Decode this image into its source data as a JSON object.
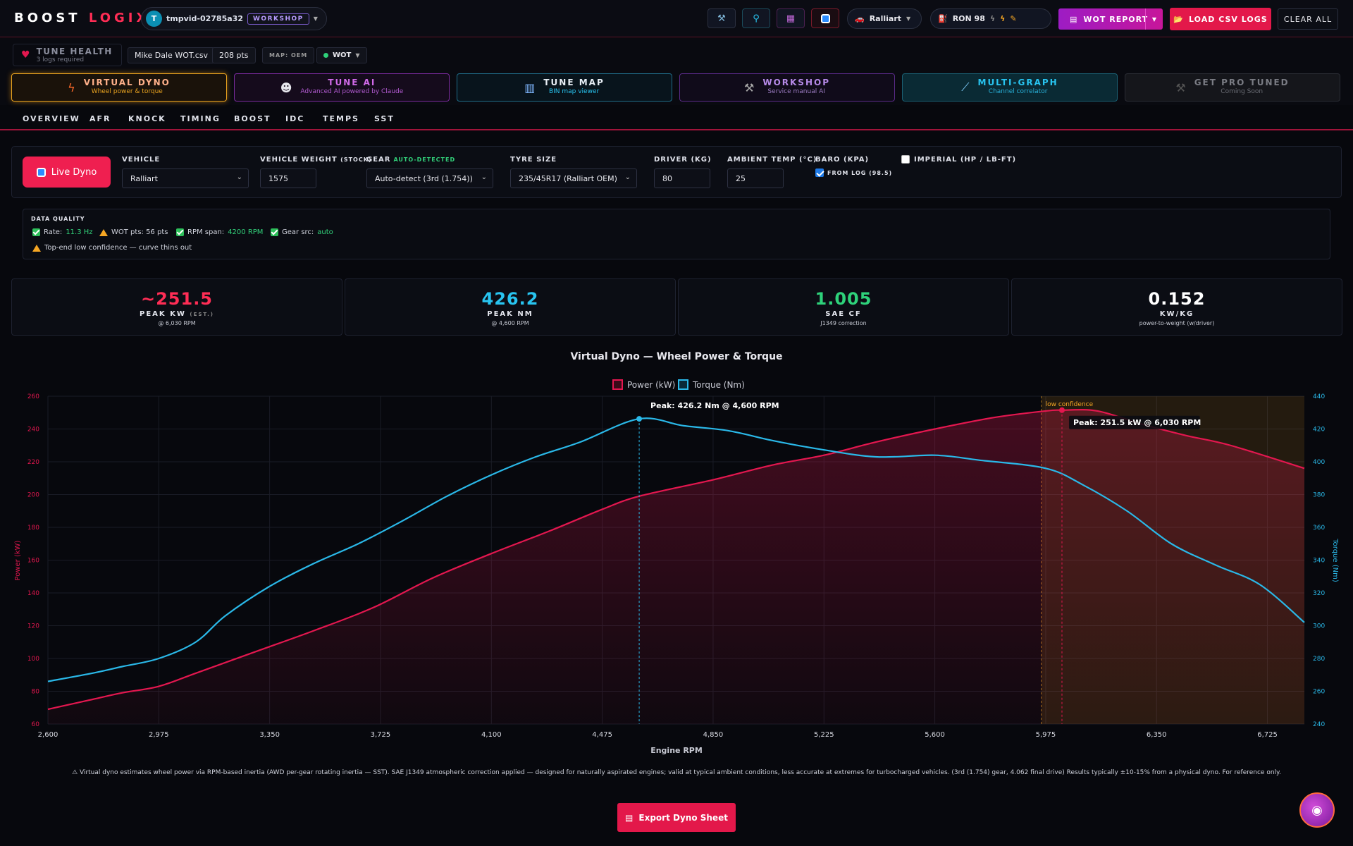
{
  "app": {
    "logo_main": "BOOST",
    "logo_accent": "LOGIX"
  },
  "user": {
    "initial": "T",
    "name": "tmpvid-02785a32",
    "workspace": "WORKSHOP"
  },
  "toolbar": {
    "vehicle_pill": "Ralliart",
    "fuel_pill": "RON 98",
    "wot_report": "WOT REPORT",
    "load_csv": "LOAD CSV LOGS",
    "clear_all": "CLEAR ALL"
  },
  "session": {
    "health_title": "TUNE HEALTH",
    "health_sub": "3 logs required",
    "file": "Mike Dale WOT.csv",
    "points": "208 pts",
    "map": "MAP: OEM",
    "mode": "WOT"
  },
  "modules": [
    {
      "title": "VIRTUAL DYNO",
      "sub": "Wheel power & torque"
    },
    {
      "title": "TUNE AI",
      "sub": "Advanced AI powered by Claude"
    },
    {
      "title": "TUNE MAP",
      "sub": "BIN map viewer"
    },
    {
      "title": "WORKSHOP",
      "sub": "Service manual AI"
    },
    {
      "title": "MULTI-GRAPH",
      "sub": "Channel correlator"
    },
    {
      "title": "GET PRO TUNED",
      "sub": "Coming Soon"
    }
  ],
  "tabs": [
    "OVERVIEW",
    "AFR",
    "KNOCK",
    "TIMING",
    "BOOST",
    "IDC",
    "TEMPS",
    "SST"
  ],
  "controls": {
    "live_dyno": "Live Dyno",
    "vehicle_label": "VEHICLE",
    "vehicle_value": "Ralliart",
    "weight_label": "VEHICLE WEIGHT",
    "weight_label_sm": "(STOCK)",
    "weight_value": "1575",
    "gear_label": "GEAR",
    "gear_auto": "AUTO-DETECTED",
    "gear_value": "Auto-detect (3rd (1.754))",
    "tyre_label": "TYRE SIZE",
    "tyre_value": "235/45R17 (Ralliart OEM)",
    "driver_label": "DRIVER (KG)",
    "driver_value": "80",
    "ambient_label": "AMBIENT TEMP (°C)",
    "ambient_value": "25",
    "baro_label": "BARO (KPA)",
    "baro_check": "FROM LOG (98.5)",
    "imperial_label": "IMPERIAL (HP / LB-FT)"
  },
  "data_quality": {
    "title": "DATA QUALITY",
    "rate_label": "Rate:",
    "rate_value": "11.3 Hz",
    "wot_label": "WOT pts: 56 pts",
    "span_label": "RPM span:",
    "span_value": "4200 RPM",
    "gear_label": "Gear src:",
    "gear_value": "auto",
    "warning": "Top-end low confidence — curve thins out"
  },
  "stats": [
    {
      "value": "~251.5",
      "label": "PEAK KW",
      "est": "(EST.)",
      "sub": "@ 6,030 RPM",
      "color": "#ff2d55"
    },
    {
      "value": "426.2",
      "label": "PEAK NM",
      "est": "",
      "sub": "@ 4,600 RPM",
      "color": "#28c4f0"
    },
    {
      "value": "1.005",
      "label": "SAE CF",
      "est": "",
      "sub": "J1349 correction",
      "color": "#2ed17a"
    },
    {
      "value": "0.152",
      "label": "KW/KG",
      "est": "",
      "sub": "power-to-weight (w/driver)",
      "color": "#ffffff"
    }
  ],
  "chart_data": {
    "type": "line",
    "title": "Virtual Dyno — Wheel Power & Torque",
    "xlabel": "Engine RPM",
    "ylabel": "Power (kW)",
    "y2label": "Torque (Nm)",
    "xlim": [
      2600,
      6850
    ],
    "ylim": [
      60,
      260
    ],
    "y2lim": [
      240,
      440
    ],
    "x_ticks": [
      2600,
      2975,
      3350,
      3725,
      4100,
      4475,
      4850,
      5225,
      5600,
      5975,
      6350,
      6725
    ],
    "x_tick_labels": [
      "2,600",
      "2,975",
      "3,350",
      "3,725",
      "4,100",
      "4,475",
      "4,850",
      "5,225",
      "5,600",
      "5,975",
      "6,350",
      "6,725"
    ],
    "y_ticks": [
      60,
      80,
      100,
      120,
      140,
      160,
      180,
      200,
      220,
      240,
      260
    ],
    "y2_ticks": [
      240,
      260,
      280,
      300,
      320,
      340,
      360,
      380,
      400,
      420,
      440
    ],
    "legend_position": "top-center",
    "grid": true,
    "series": [
      {
        "name": "Power (kW)",
        "axis": "left",
        "color": "#e3174f",
        "x": [
          2600,
          2750,
          2850,
          2975,
          3100,
          3300,
          3500,
          3700,
          3900,
          4100,
          4300,
          4475,
          4600,
          4850,
          5050,
          5225,
          5400,
          5600,
          5800,
          5975,
          6030,
          6150,
          6300,
          6450,
          6600,
          6850
        ],
        "values": [
          69,
          75,
          79,
          83,
          91,
          104,
          117,
          131,
          149,
          164,
          178,
          191,
          199,
          209,
          218,
          224,
          232,
          240,
          247,
          251,
          251.5,
          251,
          243,
          236,
          230,
          216
        ]
      },
      {
        "name": "Torque (Nm)",
        "axis": "right",
        "color": "#2ab8e8",
        "x": [
          2600,
          2750,
          2850,
          2975,
          3100,
          3200,
          3350,
          3500,
          3650,
          3800,
          3950,
          4100,
          4250,
          4400,
          4600,
          4750,
          4900,
          5050,
          5200,
          5400,
          5600,
          5750,
          5975,
          6100,
          6250,
          6400,
          6550,
          6700,
          6850
        ],
        "values": [
          266,
          271,
          275,
          280,
          290,
          306,
          324,
          338,
          350,
          364,
          379,
          392,
          403,
          412,
          426.2,
          422,
          419,
          413,
          408,
          403,
          404,
          401,
          396,
          386,
          370,
          350,
          337,
          325,
          302
        ]
      }
    ],
    "annotations": [
      {
        "type": "vline",
        "x": 4600,
        "color": "#2ab8e8",
        "label": "Peak: 426.2 Nm @ 4,600 RPM",
        "series": "Torque (Nm)",
        "y": 426.2
      },
      {
        "type": "vline",
        "x": 6030,
        "color": "#e3174f",
        "label": "Peak: 251.5 kW @ 6,030 RPM",
        "series": "Power (kW)",
        "y": 251.5
      },
      {
        "type": "region",
        "x_start": 5960,
        "x_end": 6850,
        "color": "#f5a623",
        "label": "low confidence"
      }
    ]
  },
  "disclaimer": "⚠ Virtual dyno estimates wheel power via RPM-based inertia (AWD per-gear rotating inertia — SST). SAE J1349 atmospheric correction applied — designed for naturally aspirated engines; valid at typical ambient conditions, less accurate at extremes for turbocharged vehicles. (3rd (1.754) gear, 4.062 final drive) Results typically ±10-15% from a physical dyno. For reference only.",
  "export_label": "Export Dyno Sheet"
}
